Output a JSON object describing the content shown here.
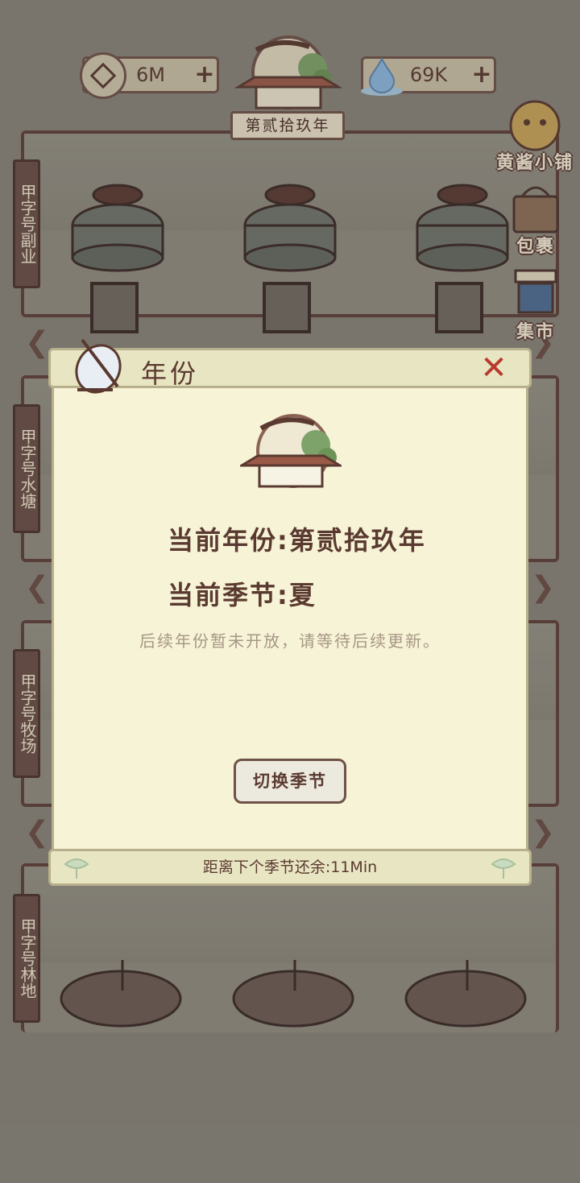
{
  "topbar": {
    "coins": {
      "value": "6M",
      "plus": "+"
    },
    "water": {
      "value": "69K",
      "plus": "+"
    },
    "year_label": "第贰拾玖年"
  },
  "side_buttons": {
    "shop": "黄酱小铺",
    "bag": "包裹",
    "market": "集市"
  },
  "fields": [
    {
      "name": "甲字号副业"
    },
    {
      "name": "甲字号水塘"
    },
    {
      "name": "甲字号牧场"
    },
    {
      "name": "甲字号林地"
    }
  ],
  "dialog": {
    "title": "年份",
    "close": "✕",
    "current_year": "当前年份:第贰拾玖年",
    "current_season": "当前季节:夏",
    "notice": "后续年份暂未开放，请等待后续更新。",
    "switch_button": "切换季节",
    "countdown": "距离下个季节还余:11Min"
  },
  "colors": {
    "background": "#878379",
    "dialog_paper": "#f7f3d6",
    "border_brown": "#6e5248",
    "close_red": "#b83a2e"
  }
}
